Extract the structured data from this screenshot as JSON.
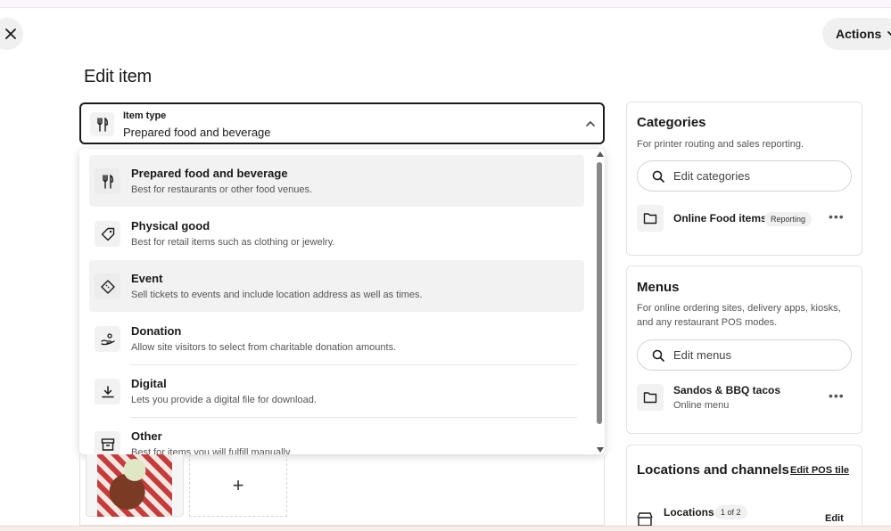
{
  "header": {
    "title": "Edit item",
    "actions_label": "Actions"
  },
  "item_type": {
    "label": "Item type",
    "value": "Prepared food and beverage"
  },
  "dropdown": {
    "options": [
      {
        "title": "Prepared food and beverage",
        "description": "Best for restaurants or other food venues.",
        "icon": "fork-knife-icon"
      },
      {
        "title": "Physical good",
        "description": "Best for retail items such as clothing or jewelry.",
        "icon": "tag-icon"
      },
      {
        "title": "Event",
        "description": "Sell tickets to events and include location address as well as times.",
        "icon": "ticket-icon"
      },
      {
        "title": "Donation",
        "description": "Allow site visitors to select from charitable donation amounts.",
        "icon": "hand-coin-icon"
      },
      {
        "title": "Digital",
        "description": "Lets you provide a digital file for download.",
        "icon": "download-icon"
      },
      {
        "title": "Other",
        "description": "Best for items you will fulfill manually.",
        "icon": "box-icon"
      }
    ]
  },
  "media": {
    "add_symbol": "+"
  },
  "categories": {
    "title": "Categories",
    "subtitle": "For printer routing and sales reporting.",
    "search_placeholder": "Edit categories",
    "item": {
      "title": "Online Food items",
      "badge": "Reporting"
    }
  },
  "menus": {
    "title": "Menus",
    "subtitle": "For online ordering sites, delivery apps, kiosks, and any restaurant POS modes.",
    "search_placeholder": "Edit menus",
    "item": {
      "title": "Sandos & BBQ tacos",
      "subtitle": "Online menu"
    }
  },
  "locations": {
    "title": "Locations and channels",
    "edit_link": "Edit POS tile",
    "row_title": "Locations",
    "row_badge": "1 of 2",
    "row_action": "Edit"
  }
}
